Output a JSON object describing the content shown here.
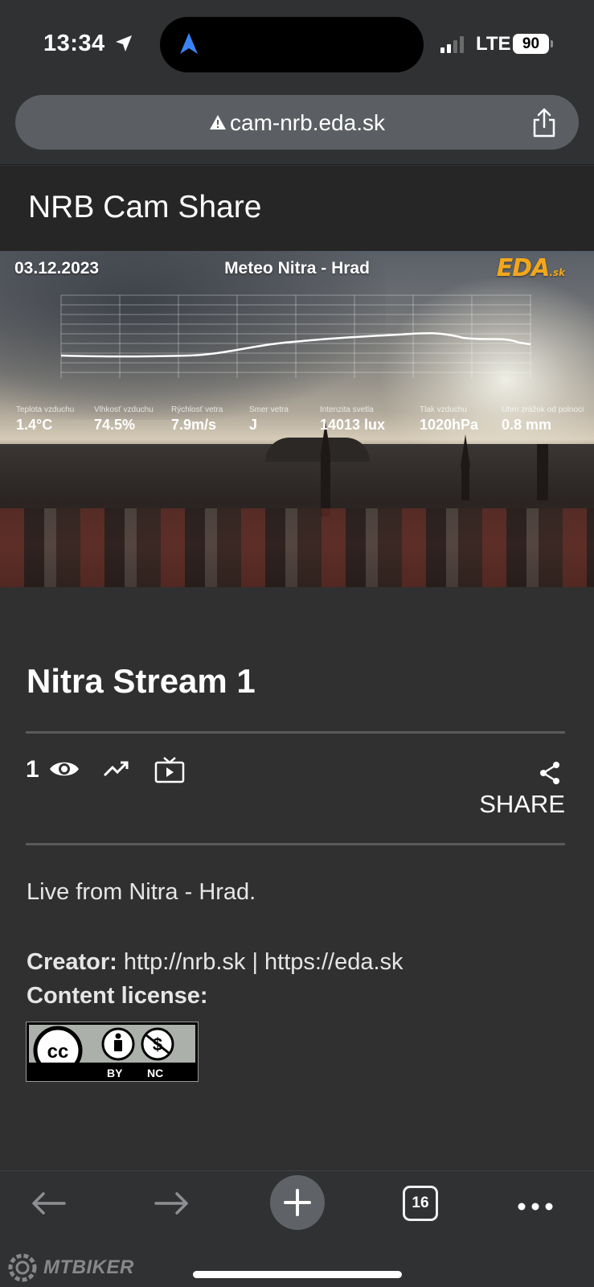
{
  "status_bar": {
    "time": "13:34",
    "network": "LTE",
    "battery": "90"
  },
  "browser": {
    "url": "cam-nrb.eda.sk",
    "tab_count": "16"
  },
  "page": {
    "title": "NRB Cam Share"
  },
  "video_overlay": {
    "date": "03.12.2023",
    "title": "Meteo Nitra - Hrad",
    "logo": "EDA",
    "logo_suffix": ".sk",
    "metrics": [
      {
        "label": "Teplota vzduchu",
        "value": "1.4°C"
      },
      {
        "label": "Vlhkosť vzduchu",
        "value": "74.5%"
      },
      {
        "label": "Rýchlosť vetra",
        "value": "7.9m/s"
      },
      {
        "label": "Smer vetra",
        "value": "J"
      },
      {
        "label": "Intenzita svetla",
        "value": "14013 lux"
      },
      {
        "label": "Tlak vzduchu",
        "value": "1020hPa"
      },
      {
        "label": "Úhrn zrážok od polnoci",
        "value": "0.8 mm"
      }
    ]
  },
  "stream": {
    "title": "Nitra Stream 1",
    "viewers": "1",
    "share_label": "SHARE",
    "description": "Live from Nitra - Hrad.",
    "creator_label": "Creator:",
    "creator_value": "http://nrb.sk | https://eda.sk",
    "license_label": "Content license:",
    "license_badge": {
      "by": "BY",
      "nc": "NC"
    }
  },
  "watermark": "MTBIKER",
  "icons": [
    "location-arrow-icon",
    "navigation-arrow-icon",
    "warning-icon",
    "share-icon",
    "eye-icon",
    "trending-icon",
    "tv-icon",
    "back-icon",
    "forward-icon",
    "plus-icon",
    "more-icon"
  ]
}
